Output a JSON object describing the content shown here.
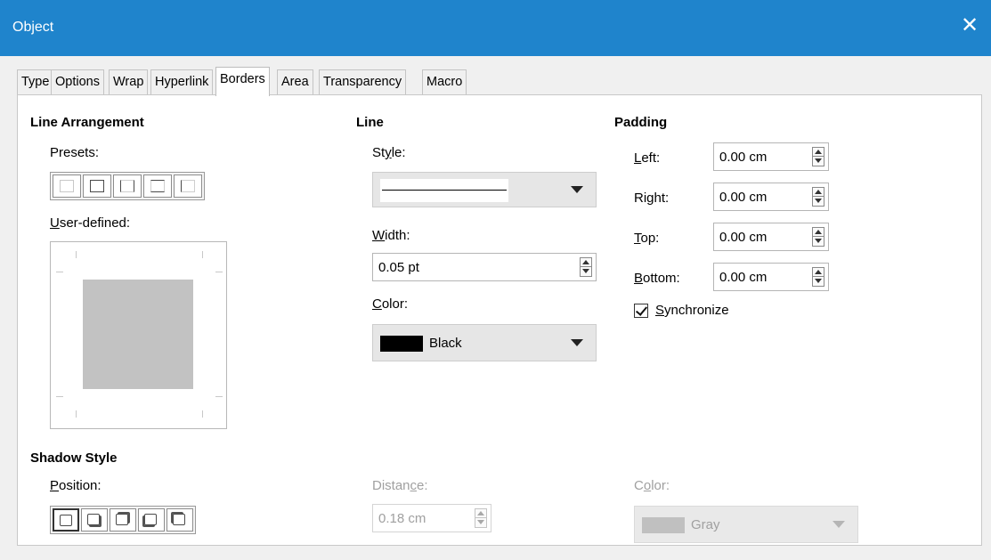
{
  "window": {
    "title": "Object",
    "close_glyph": "✕"
  },
  "tabs": [
    "Type",
    "Options",
    "Wrap",
    "Hyperlink",
    "Borders",
    "Area",
    "Transparency",
    "Macro"
  ],
  "active_tab": "Borders",
  "line_arrangement": {
    "heading": "Line Arrangement",
    "presets_label": "Presets:",
    "user_defined_label": "User-defined:"
  },
  "line": {
    "heading": "Line",
    "style_label": "Style:",
    "width_label": "Width:",
    "width_value": "0.05 pt",
    "color_label": "Color:",
    "color_value": "Black",
    "color_swatch": "#000000"
  },
  "padding": {
    "heading": "Padding",
    "left_label": "Left:",
    "left_value": "0.00 cm",
    "right_label": "Right:",
    "right_value": "0.00 cm",
    "top_label": "Top:",
    "top_value": "0.00 cm",
    "bottom_label": "Bottom:",
    "bottom_value": "0.00 cm",
    "synchronize_label": "Synchronize",
    "synchronize_checked": true
  },
  "shadow_style": {
    "heading": "Shadow Style",
    "position_label": "Position:",
    "distance_label": "Distance:",
    "distance_value": "0.18 cm",
    "color_label": "Color:",
    "color_value": "Gray",
    "color_swatch": "#c0c0c0"
  },
  "colors": {
    "titlebar": "#1f84cc"
  }
}
